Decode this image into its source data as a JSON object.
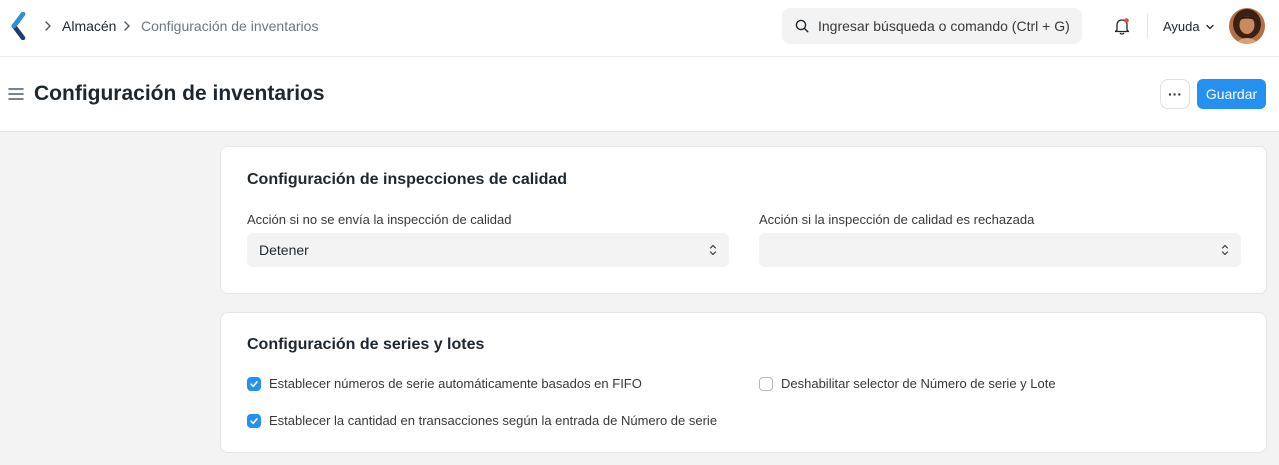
{
  "navbar": {
    "breadcrumbs": [
      "Almacén",
      "Configuración de inventarios"
    ],
    "search_placeholder": "Ingresar búsqueda o comando (Ctrl + G)",
    "help_label": "Ayuda"
  },
  "page": {
    "title": "Configuración de inventarios",
    "menu_label": "···",
    "save_label": "Guardar"
  },
  "quality_section": {
    "title": "Configuración de inspecciones de calidad",
    "fields": [
      {
        "label": "Acción si no se envía la inspección de calidad",
        "value": "Detener"
      },
      {
        "label": "Acción si la inspección de calidad es rechazada",
        "value": ""
      }
    ]
  },
  "serial_section": {
    "title": "Configuración de series y lotes",
    "checkboxes": [
      {
        "label": "Establecer números de serie automáticamente basados en FIFO",
        "checked": true
      },
      {
        "label": "Deshabilitar selector de Número de serie y Lote",
        "checked": false
      },
      {
        "label": "Establecer la cantidad en transacciones según la entrada de Número de serie",
        "checked": true
      }
    ]
  },
  "colors": {
    "primary": "#2490ef",
    "background": "#f3f3f3",
    "card": "#ffffff"
  },
  "icons": [
    "app-logo-icon",
    "chevron-right-icon",
    "search-icon",
    "bell-icon",
    "chevron-down-icon",
    "hamburger-icon",
    "select-arrows-icon",
    "checkmark-icon"
  ]
}
